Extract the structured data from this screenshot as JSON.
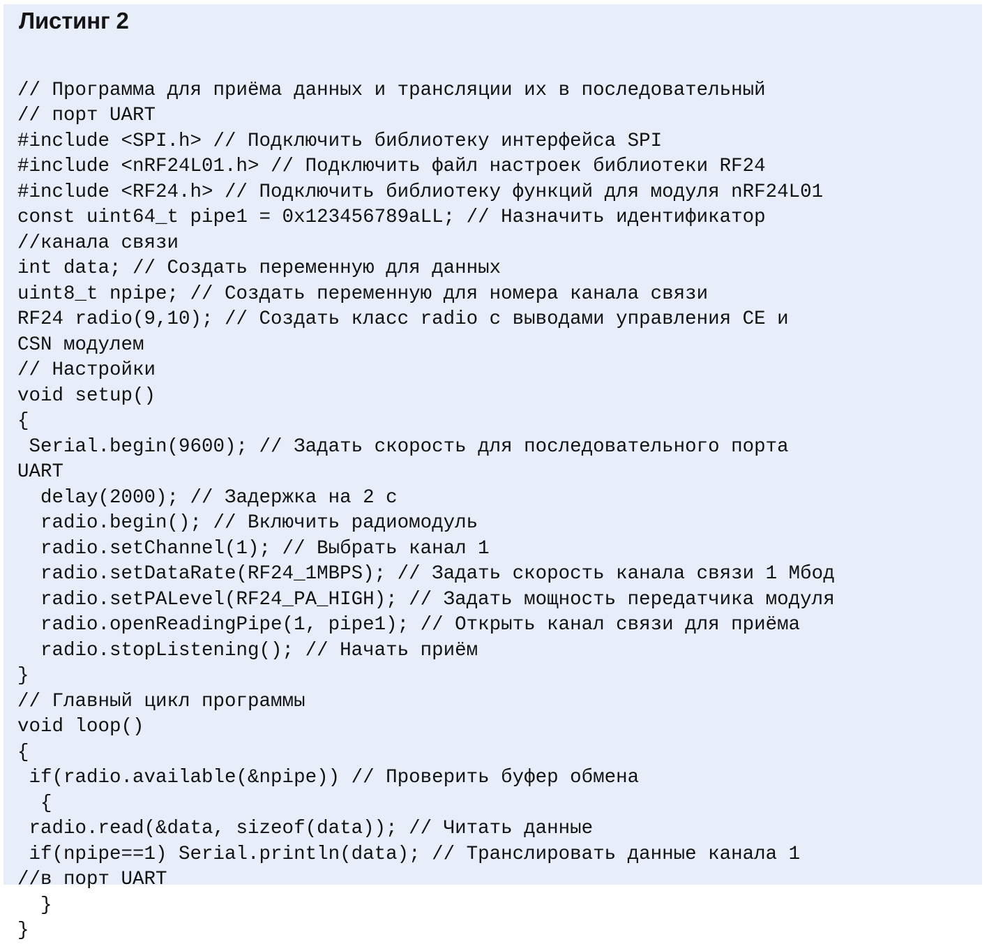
{
  "listing": {
    "title": "Листинг 2",
    "background_color": "#e7eefa",
    "text_color": "#121212",
    "language": "arduino-c++",
    "code_lines": [
      "// Программа для приёма данных и трансляции их в последовательный",
      "// порт UART",
      "#include <SPI.h> // Подключить библиотеку интерфейса SPI",
      "#include <nRF24L01.h> // Подключить файл настроек библиотеки RF24",
      "#include <RF24.h> // Подключить библиотеку функций для модуля nRF24L01",
      "const uint64_t pipe1 = 0x123456789aLL; // Назначить идентификатор",
      "//канала связи",
      "int data; // Создать переменную для данных",
      "uint8_t npipe; // Создать переменную для номера канала связи",
      "RF24 radio(9,10); // Создать класс radio с выводами управления CE и",
      "CSN модулем",
      "// Настройки",
      "void setup()",
      "{",
      " Serial.begin(9600); // Задать скорость для последовательного порта",
      "UART",
      "  delay(2000); // Задержка на 2 с",
      "  radio.begin(); // Включить радиомодуль",
      "  radio.setChannel(1); // Выбрать канал 1",
      "  radio.setDataRate(RF24_1MBPS); // Задать скорость канала связи 1 Мбод",
      "  radio.setPALevel(RF24_PA_HIGH); // Задать мощность передатчика модуля",
      "  radio.openReadingPipe(1, pipe1); // Открыть канал связи для приёма",
      "  radio.stopListening(); // Начать приём",
      "}",
      "// Главный цикл программы",
      "void loop()",
      "{",
      " if(radio.available(&npipe)) // Проверить буфер обмена",
      "  {",
      " radio.read(&data, sizeof(data)); // Читать данные",
      " if(npipe==1) Serial.println(data); // Транслировать данные канала 1",
      "//в порт UART",
      "  }",
      "}"
    ]
  }
}
